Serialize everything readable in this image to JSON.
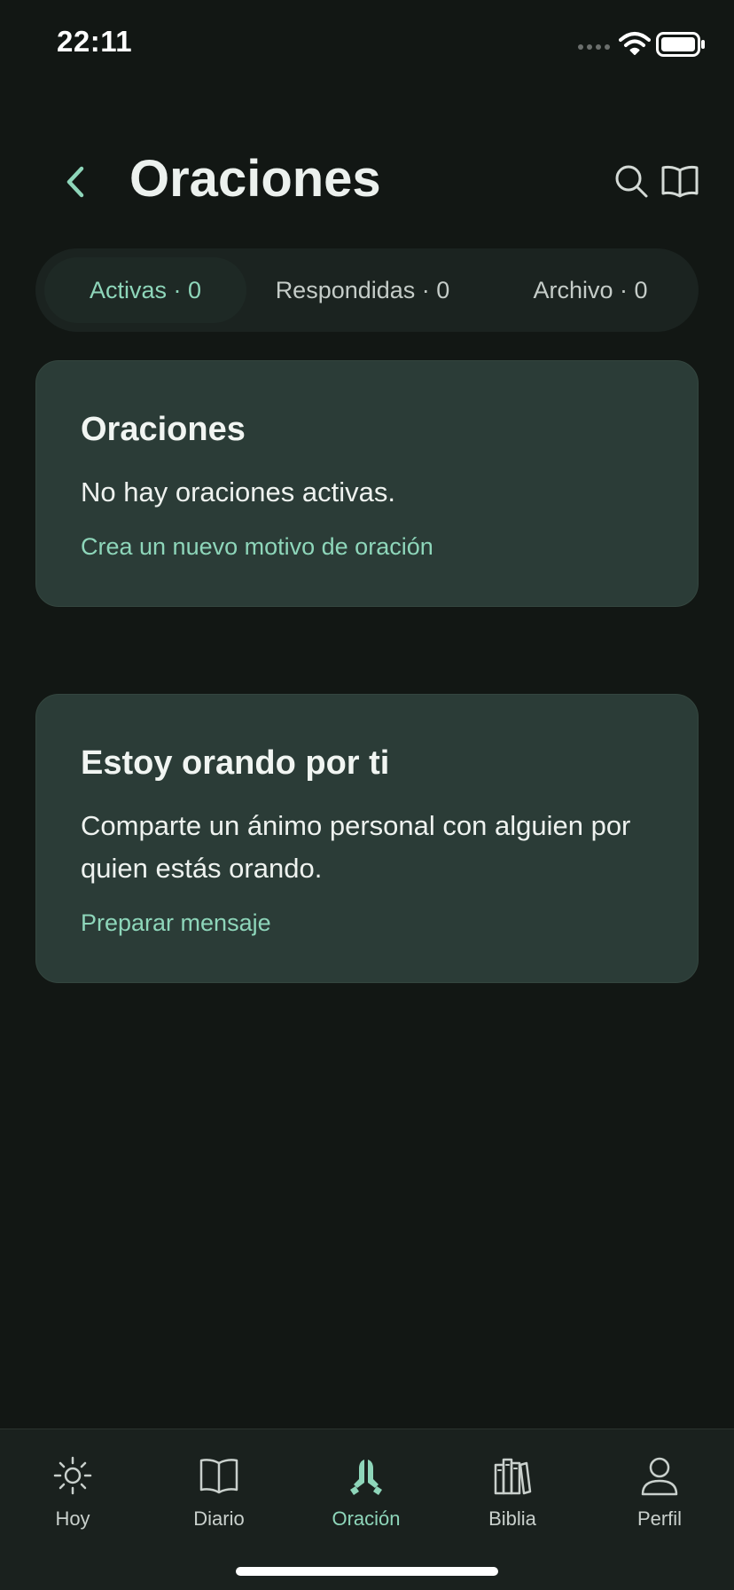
{
  "status_bar": {
    "time": "22:11"
  },
  "header": {
    "title": "Oraciones",
    "back_icon": "chevron-left-icon",
    "search_icon": "search-icon",
    "book_icon": "open-book-icon"
  },
  "tabs": [
    {
      "label": "Activas · 0",
      "active": true
    },
    {
      "label": "Respondidas · 0",
      "active": false
    },
    {
      "label": "Archivo · 0",
      "active": false
    }
  ],
  "cards": [
    {
      "title": "Oraciones",
      "text": "No hay oraciones activas.",
      "link": "Crea un nuevo motivo de oración"
    },
    {
      "title": "Estoy orando por ti",
      "text": "Comparte un ánimo personal con alguien por quien estás orando.",
      "link": "Preparar mensaje"
    }
  ],
  "bottom_nav": [
    {
      "label": "Hoy",
      "icon": "sun-icon",
      "active": false
    },
    {
      "label": "Diario",
      "icon": "book-icon",
      "active": false
    },
    {
      "label": "Oración",
      "icon": "praying-hands-icon",
      "active": true
    },
    {
      "label": "Biblia",
      "icon": "bookshelf-icon",
      "active": false
    },
    {
      "label": "Perfil",
      "icon": "person-icon",
      "active": false
    }
  ],
  "colors": {
    "background": "#121714",
    "card": "#2B3C37",
    "accent": "#8ED6BA",
    "text": "#ECF1EE",
    "nav_background": "#1A211E"
  }
}
